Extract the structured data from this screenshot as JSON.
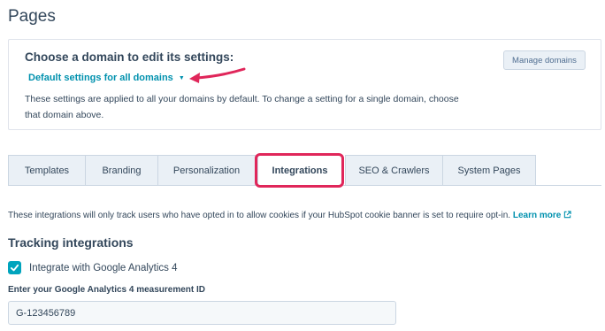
{
  "page_title": "Pages",
  "domain_section": {
    "heading": "Choose a domain to edit its settings:",
    "selected_domain": "Default settings for all domains",
    "description_line1": "These settings are applied to all your domains by default. To change a setting for a single domain, choose",
    "description_line2": "that domain above.",
    "manage_button": "Manage domains"
  },
  "tabs": [
    {
      "label": "Templates",
      "active": false
    },
    {
      "label": "Branding",
      "active": false
    },
    {
      "label": "Personalization",
      "active": false
    },
    {
      "label": "Integrations",
      "active": true
    },
    {
      "label": "SEO & Crawlers",
      "active": false
    },
    {
      "label": "System Pages",
      "active": false
    }
  ],
  "integrations": {
    "info_text": "These integrations will only track users who have opted in to allow cookies if your HubSpot cookie banner is set to require opt-in.",
    "learn_more": "Learn more",
    "section_title": "Tracking integrations",
    "ga4_checkbox_label": "Integrate with Google Analytics 4",
    "ga4_checked": true,
    "measurement_id_label": "Enter your Google Analytics 4 measurement ID",
    "measurement_id_value": "G-123456789"
  },
  "colors": {
    "accent": "#0091ae",
    "checkbox": "#00a4bd",
    "annotation": "#e0265a",
    "text": "#33475b"
  },
  "icons": [
    "caret-down-icon",
    "annotation-arrow-icon",
    "external-link-icon",
    "checkmark-icon"
  ]
}
